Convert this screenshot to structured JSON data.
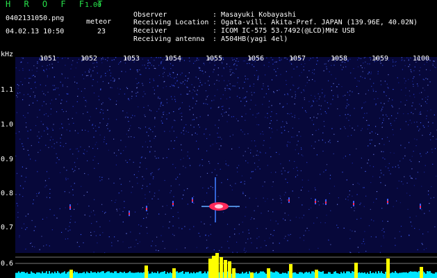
{
  "header": {
    "title": "H R O F F T",
    "version": "1.00",
    "file_name": "0402131050.png",
    "meteor_label": "meteor",
    "date_time": "04.02.13 10:50",
    "meteor_count": "23"
  },
  "info": [
    {
      "key": "Observer",
      "value": "Masayuki Kobayashi"
    },
    {
      "key": "Receiving Location",
      "value": "Ogata-vill. Akita-Pref. JAPAN (139.96E, 40.02N)"
    },
    {
      "key": "Receiver",
      "value": "ICOM IC-575 53.7492(@LCD)MHz USB"
    },
    {
      "key": "Receiving antenna",
      "value": "A504HB(yagi 4el)"
    }
  ],
  "spectrogram": {
    "y_unit": "kHz",
    "y_ticks": [
      "1.1",
      "1.0",
      "0.9",
      "0.8",
      "0.7",
      "0.6"
    ],
    "x_ticks": [
      "1051",
      "1052",
      "1053",
      "1054",
      "1055",
      "1056",
      "1057",
      "1058",
      "1059",
      "1100"
    ],
    "colors": {
      "background": "#000000",
      "noise_low": "#0a0a55",
      "noise_high": "#3b5cff",
      "echo": "#ff2a5a",
      "bar": "#ffff00",
      "baseline": "#00e5ff"
    }
  }
}
